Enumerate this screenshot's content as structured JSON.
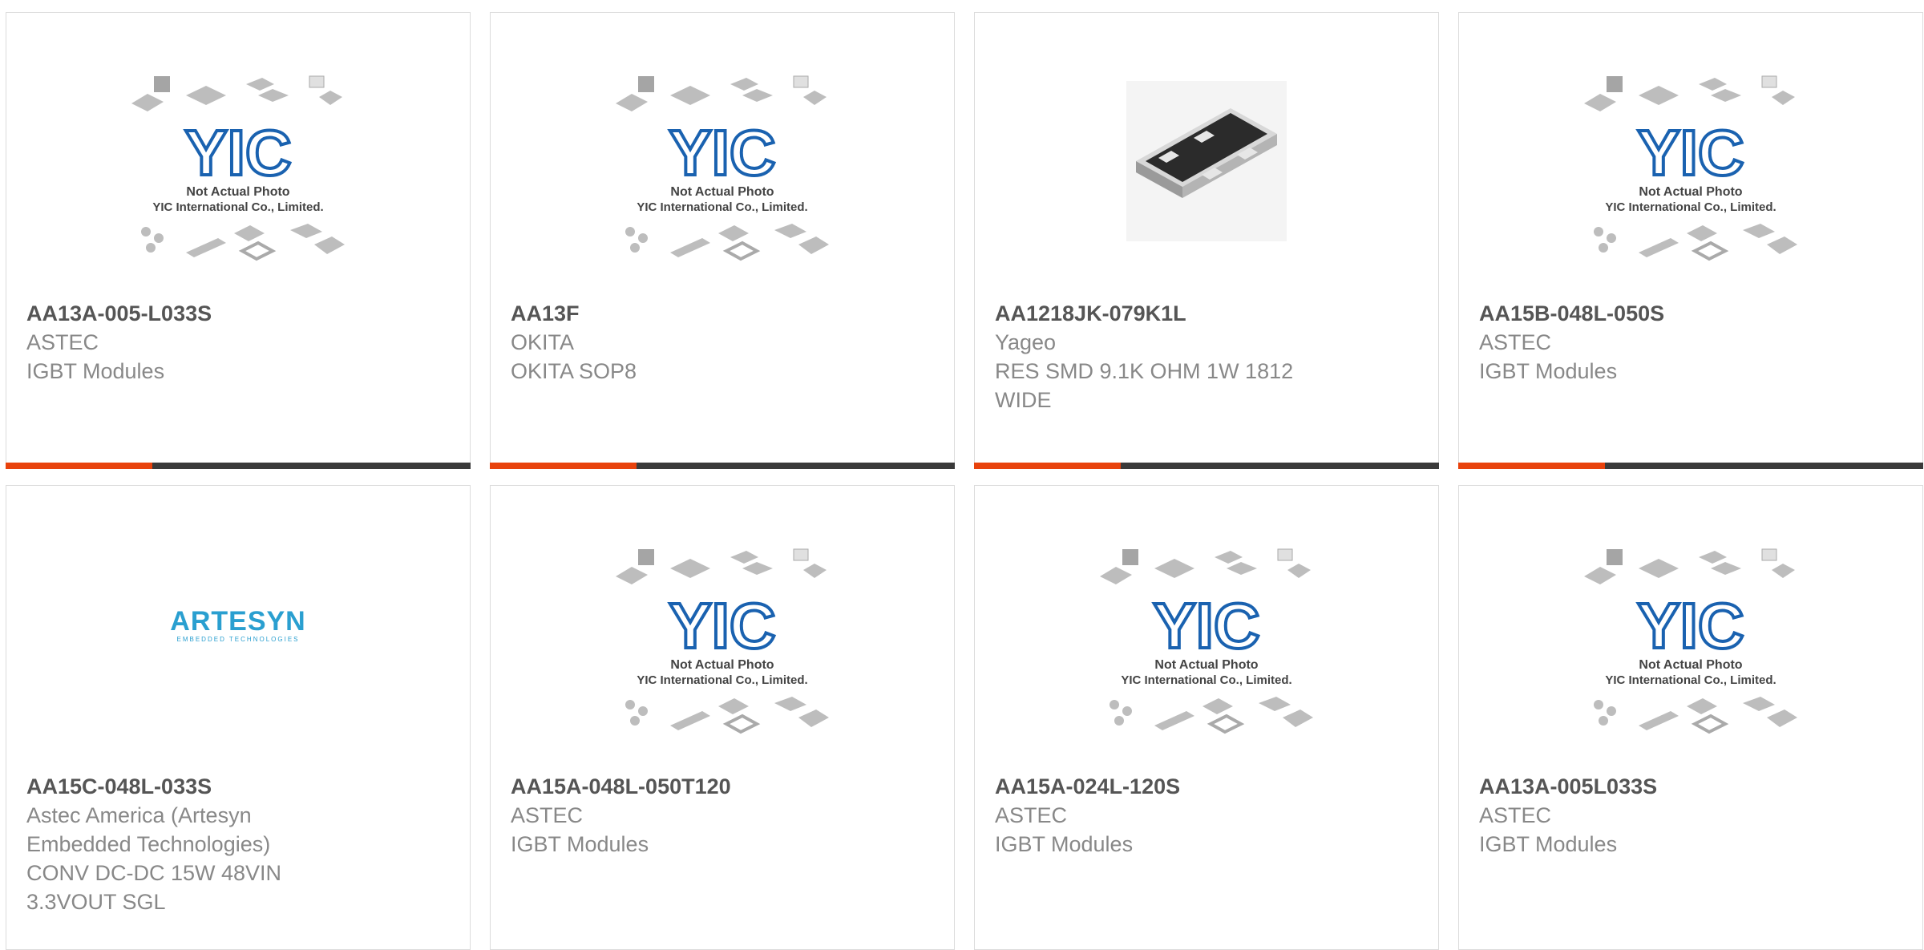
{
  "accent_color": "#e8420c",
  "bar_color": "#3a3a3a",
  "placeholder": {
    "line1": "Not Actual Photo",
    "line2": "YIC International Co., Limited.",
    "logo": "YIC"
  },
  "artesyn": {
    "brand": "ARTESYN",
    "tag": "EMBEDDED TECHNOLOGIES"
  },
  "products": [
    {
      "part": "AA13A-005-L033S",
      "mfr": "ASTEC",
      "desc": "IGBT Modules",
      "image": "placeholder"
    },
    {
      "part": "AA13F",
      "mfr": "OKITA",
      "desc": "OKITA SOP8",
      "image": "placeholder"
    },
    {
      "part": "AA1218JK-079K1L",
      "mfr": "Yageo",
      "desc": "RES SMD 9.1K OHM 1W 1812 WIDE",
      "image": "resistor"
    },
    {
      "part": "AA15B-048L-050S",
      "mfr": "ASTEC",
      "desc": "IGBT Modules",
      "image": "placeholder"
    },
    {
      "part": "AA15C-048L-033S",
      "mfr": "Astec America (Artesyn Embedded Technologies)",
      "desc": "CONV DC-DC 15W 48VIN 3.3VOUT SGL",
      "image": "artesyn"
    },
    {
      "part": "AA15A-048L-050T120",
      "mfr": "ASTEC",
      "desc": "IGBT Modules",
      "image": "placeholder"
    },
    {
      "part": "AA15A-024L-120S",
      "mfr": "ASTEC",
      "desc": "IGBT Modules",
      "image": "placeholder"
    },
    {
      "part": "AA13A-005L033S",
      "mfr": "ASTEC",
      "desc": "IGBT Modules",
      "image": "placeholder"
    }
  ]
}
